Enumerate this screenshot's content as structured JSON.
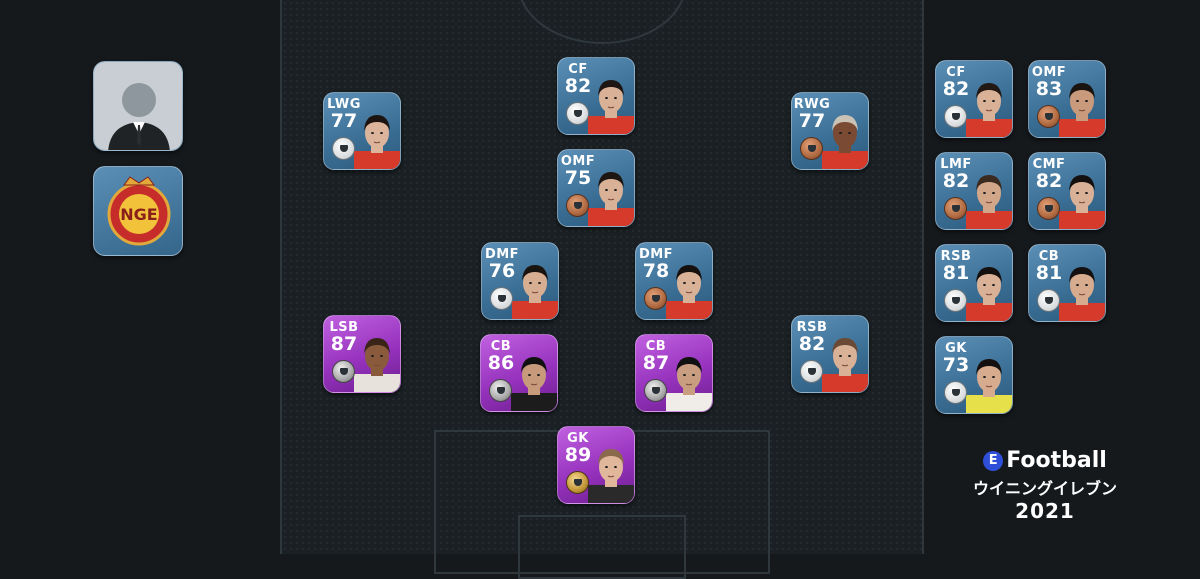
{
  "pitch_players": [
    {
      "pos": "CF",
      "rating": "82",
      "badge": "white",
      "card": "std",
      "skin": "#d9b196",
      "hair": "#1e1612",
      "shirt": "#d63a2a"
    },
    {
      "pos": "LWG",
      "rating": "77",
      "badge": "white",
      "card": "std",
      "skin": "#dcb49b",
      "hair": "#1b1410",
      "shirt": "#d63a2a"
    },
    {
      "pos": "RWG",
      "rating": "77",
      "badge": "bronze",
      "card": "std",
      "skin": "#7a4a32",
      "hair": "#c9c2b5",
      "shirt": "#d63a2a"
    },
    {
      "pos": "OMF",
      "rating": "75",
      "badge": "bronze",
      "card": "std",
      "skin": "#d9b196",
      "hair": "#1e1612",
      "shirt": "#d63a2a"
    },
    {
      "pos": "DMF",
      "rating": "76",
      "badge": "white",
      "card": "std",
      "skin": "#d8ae92",
      "hair": "#1a1410",
      "shirt": "#d63a2a"
    },
    {
      "pos": "DMF",
      "rating": "78",
      "badge": "bronze",
      "card": "std",
      "skin": "#d9b196",
      "hair": "#15100d",
      "shirt": "#d63a2a"
    },
    {
      "pos": "LSB",
      "rating": "87",
      "badge": "silver",
      "card": "legend",
      "skin": "#8a5a3c",
      "hair": "#3a2418",
      "shirt": "#e8e2dc"
    },
    {
      "pos": "CB",
      "rating": "86",
      "badge": "silver",
      "card": "legend",
      "skin": "#c89a7c",
      "hair": "#111111",
      "shirt": "#1c1c1c"
    },
    {
      "pos": "CB",
      "rating": "87",
      "badge": "silver",
      "card": "legend",
      "skin": "#c99d80",
      "hair": "#111111",
      "shirt": "#f0ece8"
    },
    {
      "pos": "RSB",
      "rating": "82",
      "badge": "white",
      "card": "std",
      "skin": "#d9b196",
      "hair": "#6a4a34",
      "shirt": "#d63a2a"
    },
    {
      "pos": "GK",
      "rating": "89",
      "badge": "gold",
      "card": "legend",
      "skin": "#e1b79c",
      "hair": "#8a6a4a",
      "shirt": "#2a2a2a"
    }
  ],
  "subs": [
    {
      "pos": "CF",
      "rating": "82",
      "badge": "white",
      "card": "std",
      "skin": "#d9b196",
      "hair": "#221814",
      "shirt": "#d63a2a"
    },
    {
      "pos": "OMF",
      "rating": "83",
      "badge": "bronze",
      "card": "std",
      "skin": "#c99a7c",
      "hair": "#1a1410",
      "shirt": "#d63a2a"
    },
    {
      "pos": "LMF",
      "rating": "82",
      "badge": "bronze",
      "card": "std",
      "skin": "#d2a688",
      "hair": "#3a2a20",
      "shirt": "#d63a2a"
    },
    {
      "pos": "CMF",
      "rating": "82",
      "badge": "bronze",
      "card": "std",
      "skin": "#d9b196",
      "hair": "#151010",
      "shirt": "#d63a2a"
    },
    {
      "pos": "RSB",
      "rating": "81",
      "badge": "white",
      "card": "std",
      "skin": "#d9b196",
      "hair": "#151010",
      "shirt": "#d63a2a"
    },
    {
      "pos": "CB",
      "rating": "81",
      "badge": "white",
      "card": "std",
      "skin": "#d6ab8e",
      "hair": "#151010",
      "shirt": "#d63a2a"
    },
    {
      "pos": "GK",
      "rating": "73",
      "badge": "white",
      "card": "std",
      "skin": "#d6ab8e",
      "hair": "#151010",
      "shirt": "#e6e14a"
    }
  ],
  "logo": {
    "e_letter": "E",
    "brand": "Football",
    "subtitle": "ウイニングイレブン",
    "year": "2021"
  },
  "icons": {
    "manager": "manager-silhouette-icon",
    "club": "team-emblem-icon"
  }
}
